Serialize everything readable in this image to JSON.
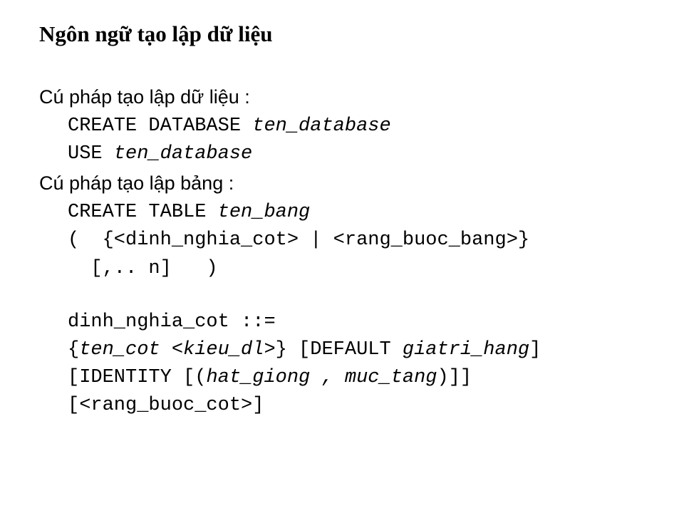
{
  "title": "Ngôn ngữ tạo lập dữ liệu",
  "section1": {
    "heading": "Cú pháp tạo lập dữ liệu :",
    "line1_keyword": "CREATE DATABASE ",
    "line1_param": "ten_database",
    "line2_keyword": "USE ",
    "line2_param": "ten_database"
  },
  "section2": {
    "heading": "Cú pháp tạo lập bảng :",
    "line1_keyword": "CREATE TABLE ",
    "line1_param": "ten_bang",
    "line2": "(  {<dinh_nghia_cot> | <rang_buoc_bang>}",
    "line3": "  [,.. n]   )",
    "line4": "dinh_nghia_cot ::=",
    "line5_a": "{",
    "line5_b": "ten_cot <kieu_dl>",
    "line5_c": "} [DEFAULT ",
    "line5_d": "giatri_hang",
    "line5_e": "]",
    "line6_a": "[IDENTITY [(",
    "line6_b": "hat_giong , muc_tang",
    "line6_c": ")]]",
    "line7": "[<rang_buoc_cot>]"
  }
}
